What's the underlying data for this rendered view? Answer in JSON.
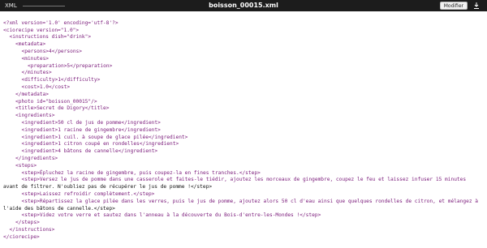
{
  "header": {
    "tab_label": "XML",
    "file_title": "boisson_00015.xml",
    "modify_label": "Modifier",
    "download_icon": "download-icon"
  },
  "xml": {
    "declaration": "<?xml version='1.0' encoding='utf-8'?>",
    "l_ciorecipe_open": "<ciorecipe version=\"1.0\">",
    "l_instructions_open": "<instructions dish=\"drink\">",
    "l_metadata_open": "<metadata>",
    "l_persons": "<persons>4</persons>",
    "l_minutes_open": "<minutes>",
    "l_preparation": "<preparation>5</preparation>",
    "l_minutes_close": "</minutes>",
    "l_difficulty": "<difficulty>1</difficulty>",
    "l_cost": "<cost>1.0</cost>",
    "l_metadata_close": "</metadata>",
    "l_photo": "<photo id=\"boisson_00015\"/>",
    "l_title": "<title>Secret de Digory</title>",
    "l_ingredients_open": "<ingredients>",
    "l_ing1": "<ingredient>50 cl de jus de pomme</ingredient>",
    "l_ing2": "<ingredient>1 racine de gingembre</ingredient>",
    "l_ing3": "<ingredient>1 cuil. à soupe de glace pilée</ingredient>",
    "l_ing4": "<ingredient>1 citron coupé en rondelles</ingredient>",
    "l_ing5": "<ingredient>4 bâtons de cannelle</ingredient>",
    "l_ingredients_close": "</ingredients>",
    "l_steps_open": "<steps>",
    "l_step1": "<step>Épluchez la racine de gingembre, puis coupez-la en fines tranches.</step>",
    "l_step2a": "<step>Versez le jus de pomme dans une casserole et faites-le tiédir, ajoutez les morceaux de gingembre, coupez le feu et laissez infuser 15 minutes",
    "l_step2b": "avant de filtrer. N'oubliez pas de récupérer le jus de pomme !</step>",
    "l_step3": "<step>Laissez refroidir complètement.</step>",
    "l_step4a": "<step>Répartissez la glace pilée dans les verres, puis le jus de pomme, ajoutez alors 50 cl d'eau ainsi que quelques rondelles de citron, et mélangez à",
    "l_step4b": "l'aide des bâtons de cannelle.</step>",
    "l_step5": "<step>Videz votre verre et sautez dans l'anneau à la découverte du Bois-d'entre-les-Mondes !</step>",
    "l_steps_close": "</steps>",
    "l_instructions_close": "</instructions>",
    "l_ciorecipe_close": "</ciorecipe>"
  }
}
